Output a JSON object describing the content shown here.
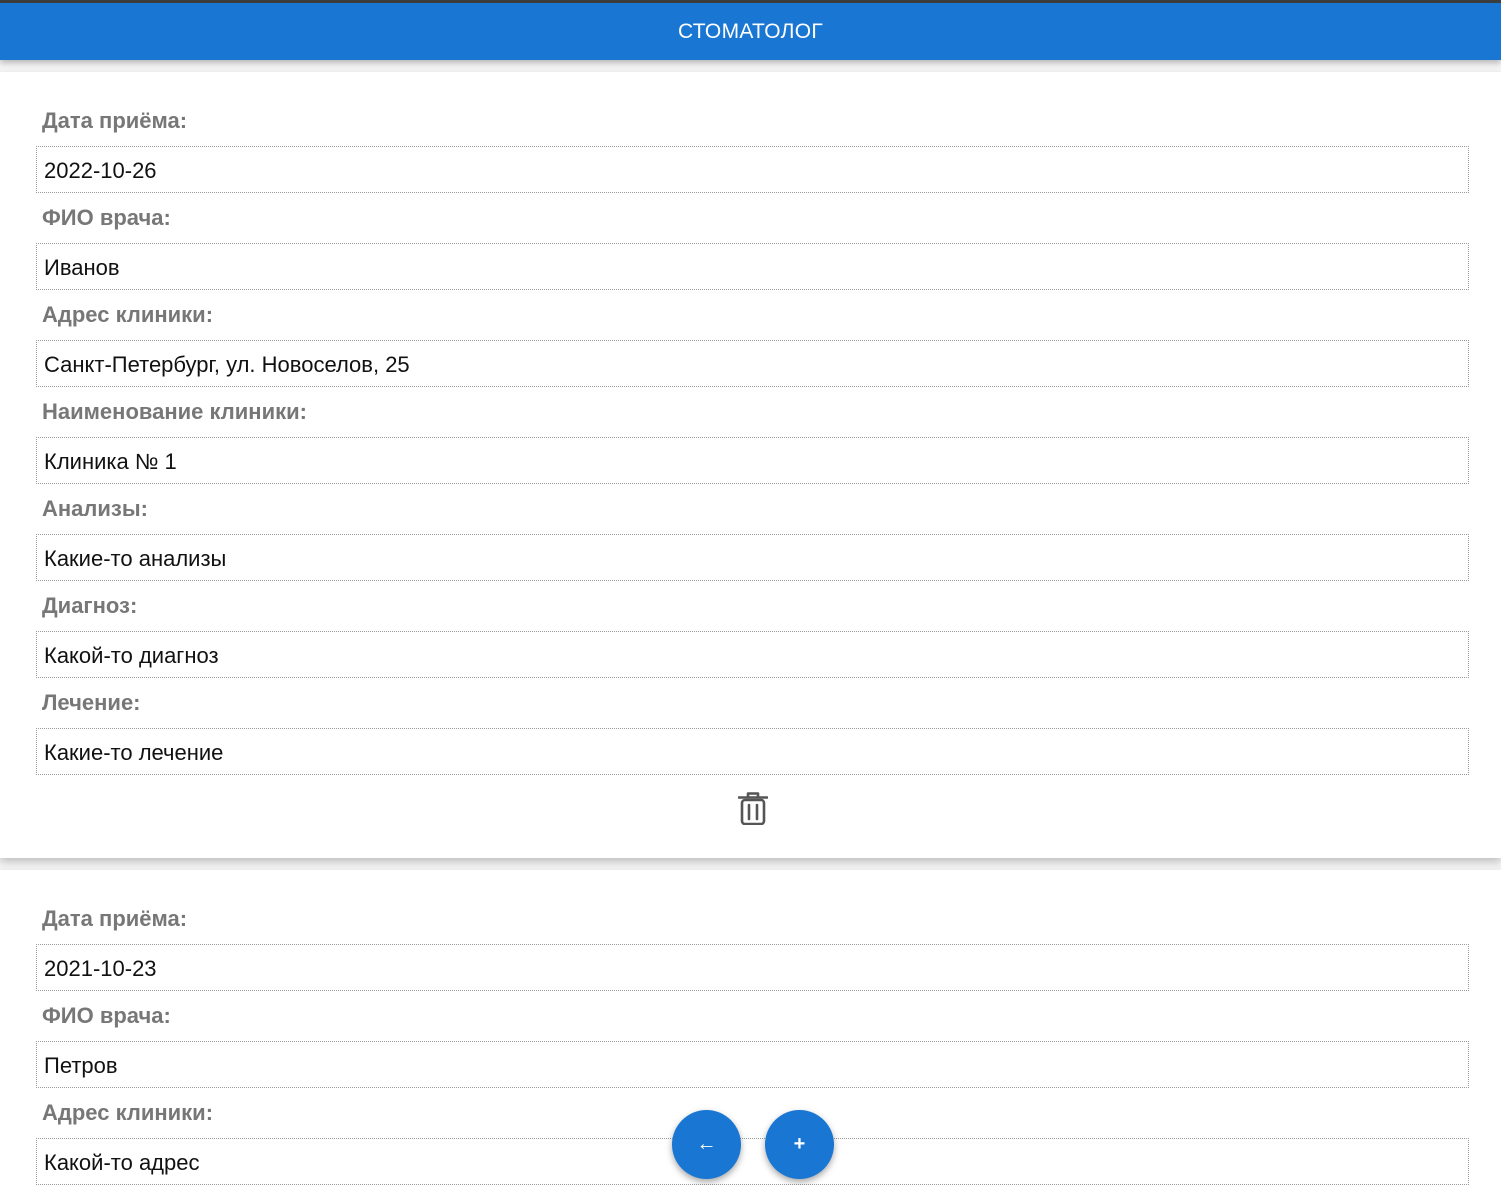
{
  "header": {
    "title": "Стоматолог"
  },
  "records": [
    {
      "fields": [
        {
          "label": "Дата приёма:",
          "value": "2022-10-26"
        },
        {
          "label": "ФИО врача:",
          "value": "Иванов"
        },
        {
          "label": "Адрес клиники:",
          "value": "Санкт-Петербург, ул. Новоселов, 25"
        },
        {
          "label": "Наименование клиники:",
          "value": "Клиника № 1"
        },
        {
          "label": "Анализы:",
          "value": "Какие-то анализы"
        },
        {
          "label": "Диагноз:",
          "value": "Какой-то диагноз"
        },
        {
          "label": "Лечение:",
          "value": "Какие-то лечение"
        }
      ],
      "delete_icon": "trash-icon"
    },
    {
      "fields": [
        {
          "label": "Дата приёма:",
          "value": "2021-10-23"
        },
        {
          "label": "ФИО врача:",
          "value": "Петров"
        },
        {
          "label": "Адрес клиники:",
          "value": "Какой-то адрес"
        }
      ]
    }
  ],
  "fabs": {
    "back_label": "←",
    "add_label": "+"
  },
  "colors": {
    "primary": "#1976d2",
    "label": "#777777",
    "text": "#111111"
  }
}
